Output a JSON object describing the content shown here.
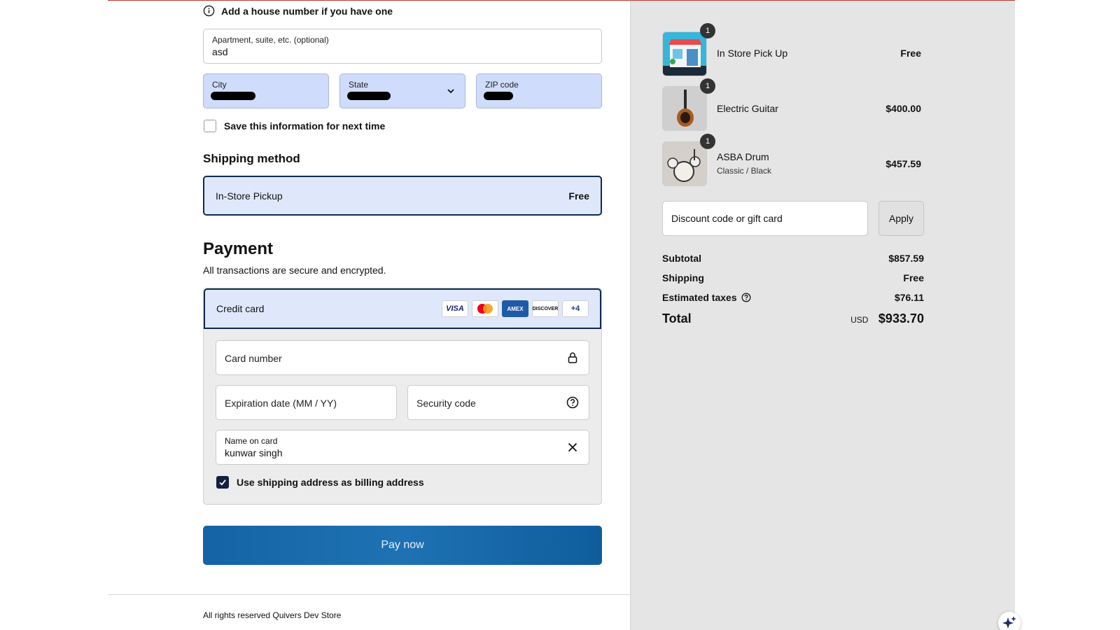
{
  "address": {
    "hint": "Add a house number if you have one",
    "apartment": {
      "label": "Apartment, suite, etc. (optional)",
      "value": "asd"
    },
    "city": {
      "label": "City"
    },
    "state": {
      "label": "State"
    },
    "zip": {
      "label": "ZIP code"
    },
    "save_info_label": "Save this information for next time"
  },
  "shipping": {
    "heading": "Shipping method",
    "option_name": "In-Store Pickup",
    "option_price": "Free"
  },
  "payment": {
    "heading": "Payment",
    "subheading": "All transactions are secure and encrypted.",
    "method_label": "Credit card",
    "card_brands": [
      "VISA",
      "MC",
      "AMEX",
      "DISCOVER"
    ],
    "more_cards": "+4",
    "card_number_placeholder": "Card number",
    "expiration_placeholder": "Expiration date (MM / YY)",
    "security_placeholder": "Security code",
    "name_on_card": {
      "label": "Name on card",
      "value": "kunwar singh"
    },
    "billing_same_label": "Use shipping address as billing address",
    "pay_button": "Pay now"
  },
  "footer": {
    "text": "All rights reserved Quivers Dev Store"
  },
  "summary": {
    "items": [
      {
        "qty": "1",
        "name": "In Store Pick Up",
        "variant": "",
        "price": "Free"
      },
      {
        "qty": "1",
        "name": "Electric Guitar",
        "variant": "",
        "price": "$400.00"
      },
      {
        "qty": "1",
        "name": "ASBA Drum",
        "variant": "Classic / Black",
        "price": "$457.59"
      }
    ],
    "discount_placeholder": "Discount code or gift card",
    "apply_label": "Apply",
    "subtotal_label": "Subtotal",
    "subtotal_value": "$857.59",
    "shipping_label": "Shipping",
    "shipping_value": "Free",
    "taxes_label": "Estimated taxes",
    "taxes_value": "$76.11",
    "total_label": "Total",
    "currency": "USD",
    "total_value": "$933.70"
  },
  "colors": {
    "accent_dark": "#0f2b4f",
    "selected_bg": "#dfe8fb",
    "autofill_bg": "#cfdcfb",
    "pay_button": "#1464a5",
    "sidebar_bg": "#e5e5e5"
  }
}
